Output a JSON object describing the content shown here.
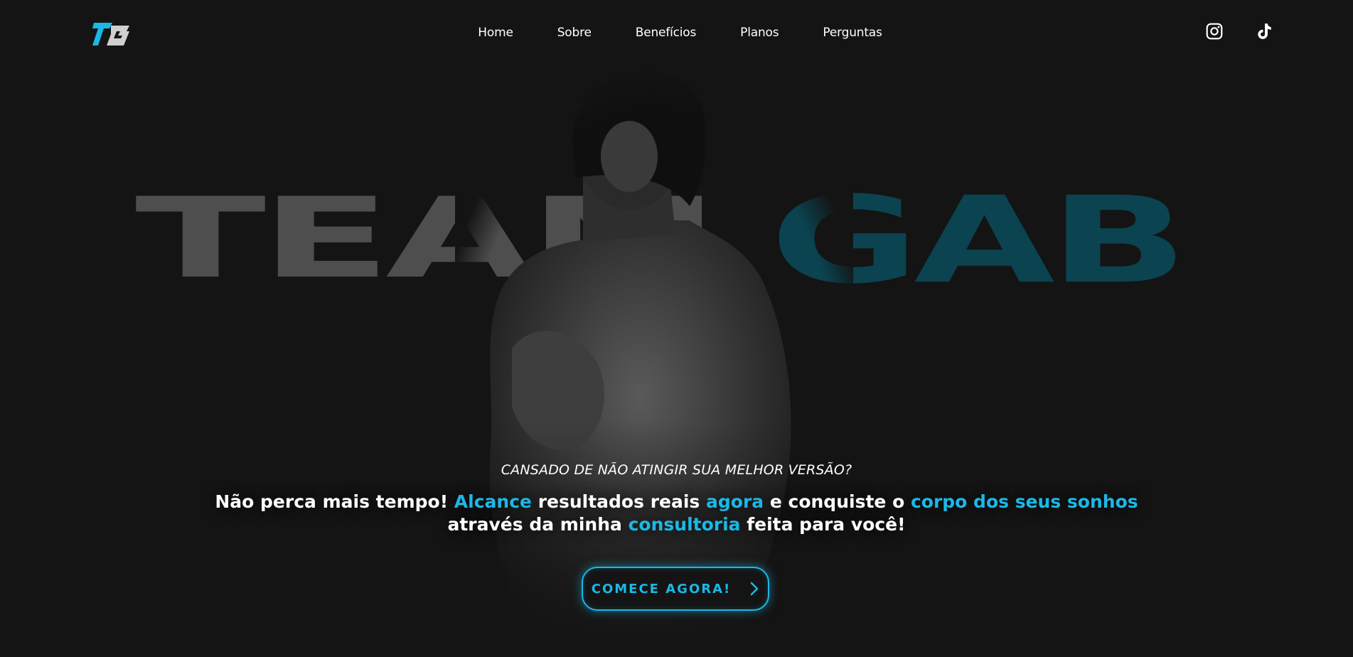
{
  "nav": {
    "items": [
      {
        "label": "Home"
      },
      {
        "label": "Sobre"
      },
      {
        "label": "Benefícios"
      },
      {
        "label": "Planos"
      },
      {
        "label": "Perguntas"
      }
    ]
  },
  "social": {
    "instagram_icon": "instagram-icon",
    "tiktok_icon": "tiktok-icon"
  },
  "hero": {
    "word_left": "TEAM",
    "word_right": "GAB",
    "subtitle": "CANSADO DE NÃO ATINGIR SUA MELHOR VERSÃO?",
    "title_parts": {
      "p1": "Não perca mais tempo! ",
      "h1": "Alcance",
      "p2": " resultados reais ",
      "h2": "agora",
      "p3": " e conquiste o ",
      "h3": "corpo dos seus sonhos",
      "p4": "através da minha ",
      "h4": "consultoria",
      "p5": " feita para você!"
    },
    "cta_label": "COMECE AGORA!"
  },
  "colors": {
    "background": "#141414",
    "accent": "#1bb8e6",
    "team_text": "#4e4e4e",
    "gab_text": "#0b4350"
  }
}
